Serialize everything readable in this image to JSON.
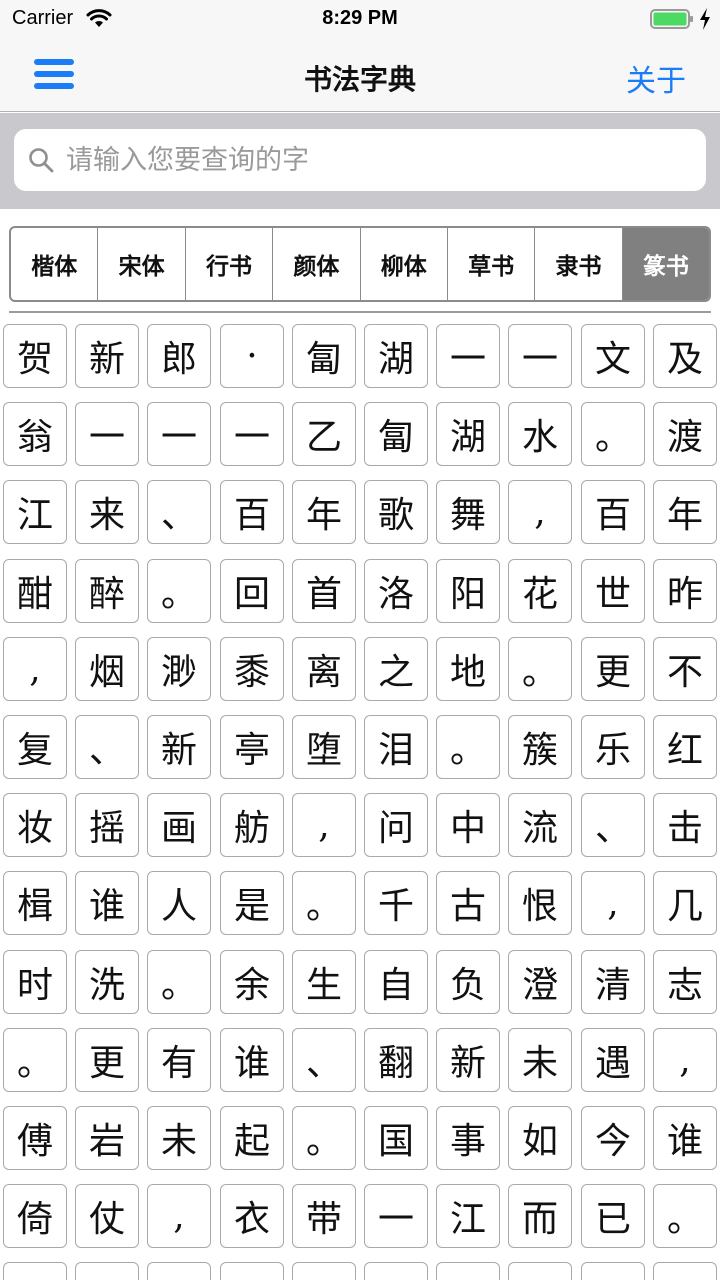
{
  "status_bar": {
    "carrier": "Carrier",
    "time": "8:29 PM",
    "battery_color": "#4cd964"
  },
  "nav": {
    "title": "书法字典",
    "about_label": "关于",
    "accent_color": "#1a7cf7",
    "menu_icon": "hamburger-menu-icon"
  },
  "search": {
    "placeholder": "请输入您要查询的字",
    "value": "",
    "icon": "search-icon"
  },
  "font_tabs": [
    {
      "label": "楷体",
      "active": false
    },
    {
      "label": "宋体",
      "active": false
    },
    {
      "label": "行书",
      "active": false
    },
    {
      "label": "颜体",
      "active": false
    },
    {
      "label": "柳体",
      "active": false
    },
    {
      "label": "草书",
      "active": false
    },
    {
      "label": "隶书",
      "active": false
    },
    {
      "label": "篆书",
      "active": true
    }
  ],
  "characters": [
    [
      "贺",
      "新",
      "郎",
      "·",
      "匐",
      "湖",
      "一",
      "一",
      "文",
      "及"
    ],
    [
      "翁",
      "一",
      "一",
      "一",
      "乙",
      "匐",
      "湖",
      "水",
      "。",
      "渡"
    ],
    [
      "江",
      "来",
      "、",
      "百",
      "年",
      "歌",
      "舞",
      ",",
      "百",
      "年"
    ],
    [
      "酣",
      "醉",
      "。",
      "回",
      "首",
      "洛",
      "阳",
      "花",
      "世",
      "昨"
    ],
    [
      ",",
      "烟",
      "渺",
      "黍",
      "离",
      "之",
      "地",
      "。",
      "更",
      "不"
    ],
    [
      "复",
      "、",
      "新",
      "亭",
      "堕",
      "泪",
      "。",
      "簇",
      "乐",
      "红"
    ],
    [
      "妆",
      "摇",
      "画",
      "舫",
      ",",
      "问",
      "中",
      "流",
      "、",
      "击"
    ],
    [
      "楫",
      "谁",
      "人",
      "是",
      "。",
      "千",
      "古",
      "恨",
      ",",
      "几"
    ],
    [
      "时",
      "洗",
      "。",
      "余",
      "生",
      "自",
      "负",
      "澄",
      "清",
      "志"
    ],
    [
      "。",
      "更",
      "有",
      "谁",
      "、",
      "翻",
      "新",
      "未",
      "遇",
      ","
    ],
    [
      "傅",
      "岩",
      "未",
      "起",
      "。",
      "国",
      "事",
      "如",
      "今",
      "谁"
    ],
    [
      "倚",
      "仗",
      ",",
      "衣",
      "带",
      "一",
      "江",
      "而",
      "已",
      "。"
    ],
    [
      "",
      "",
      "",
      "",
      "",
      "",
      "",
      "",
      "",
      ""
    ]
  ]
}
